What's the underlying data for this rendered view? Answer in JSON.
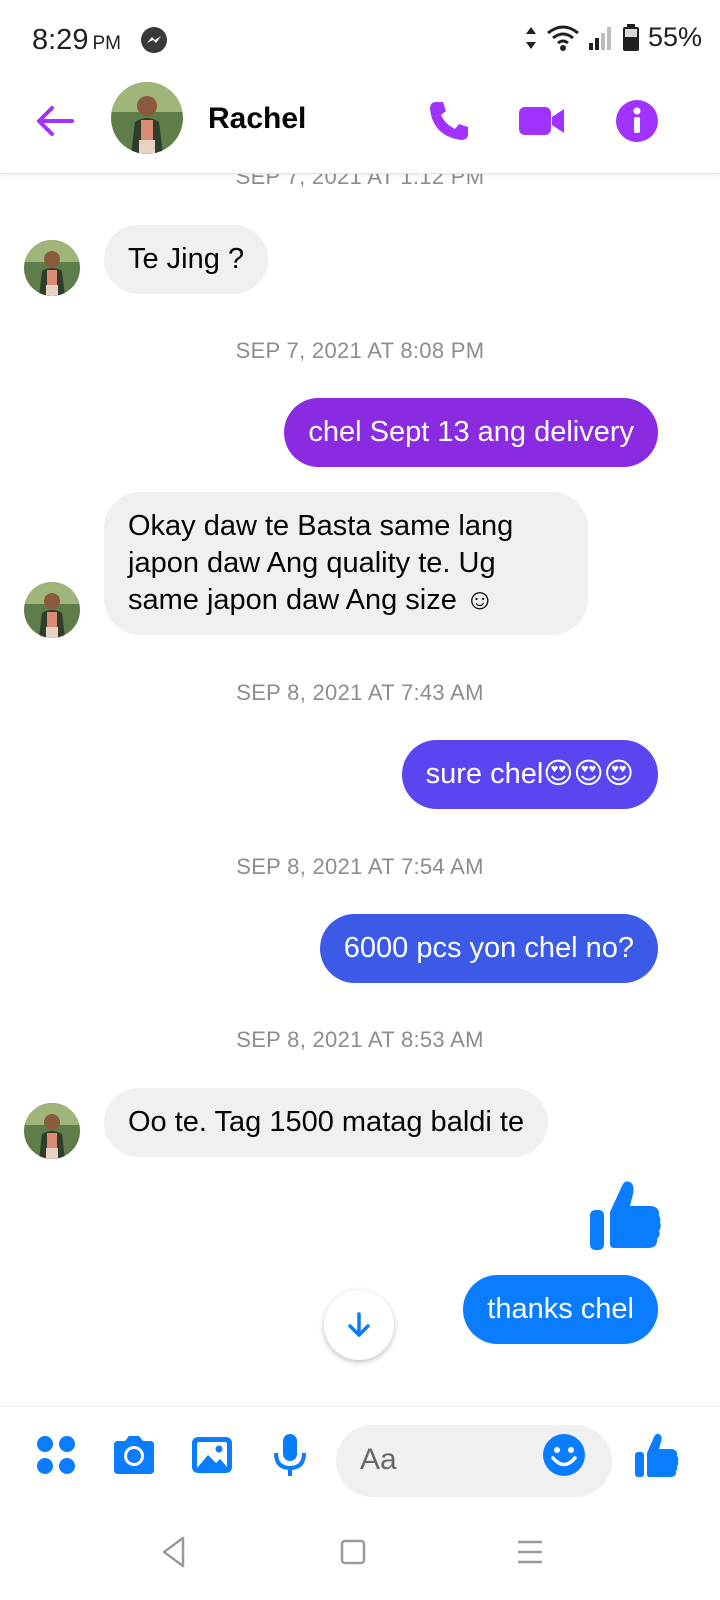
{
  "status_bar": {
    "time": "8:29",
    "ampm": "PM",
    "battery": "55%"
  },
  "header": {
    "contact_name": "Rachel",
    "back_icon": "arrow-left-icon",
    "call_icon": "phone-icon",
    "video_icon": "video-camera-icon",
    "info_icon": "info-icon"
  },
  "colors": {
    "accent": "#a033ff",
    "out_purple": "#8a2be2",
    "out_indigo": "#5b45f0",
    "out_blue": "#3c5ae8",
    "out_lightblue": "#0a7cff",
    "incoming_bg": "#f0f0f0"
  },
  "conversation": {
    "timestamps": [
      "SEP 7, 2021 AT 1:12 PM",
      "SEP 7, 2021 AT 8:08 PM",
      "SEP 8, 2021 AT 7:43 AM",
      "SEP 8, 2021 AT 7:54 AM",
      "SEP 8, 2021 AT 8:53 AM"
    ],
    "messages": [
      {
        "direction": "in",
        "lines": [
          "Te Jing ?"
        ]
      },
      {
        "direction": "out",
        "lines": [
          "chel Sept 13 ang delivery"
        ]
      },
      {
        "direction": "in",
        "lines": [
          "Okay daw te Basta same lang",
          "japon daw Ang quality te. Ug",
          "same japon daw Ang size"
        ],
        "emoji": "☺"
      },
      {
        "direction": "out",
        "lines": [
          "sure chel"
        ],
        "emoji": "😍😍😍"
      },
      {
        "direction": "out",
        "lines": [
          "6000 pcs yon chel no?"
        ]
      },
      {
        "direction": "in",
        "lines": [
          "Oo te. Tag 1500 matag baldi te"
        ]
      },
      {
        "direction": "out",
        "type": "like",
        "icon": "thumbs-up-icon"
      },
      {
        "direction": "out",
        "lines": [
          "thanks chel"
        ]
      }
    ]
  },
  "composer": {
    "placeholder": "Aa",
    "icons": [
      "apps-icon",
      "camera-icon",
      "gallery-icon",
      "microphone-icon",
      "emoji-icon",
      "thumbs-up-icon"
    ]
  },
  "navbar": {
    "icons": [
      "back-triangle-icon",
      "home-square-icon",
      "menu-lines-icon"
    ]
  }
}
